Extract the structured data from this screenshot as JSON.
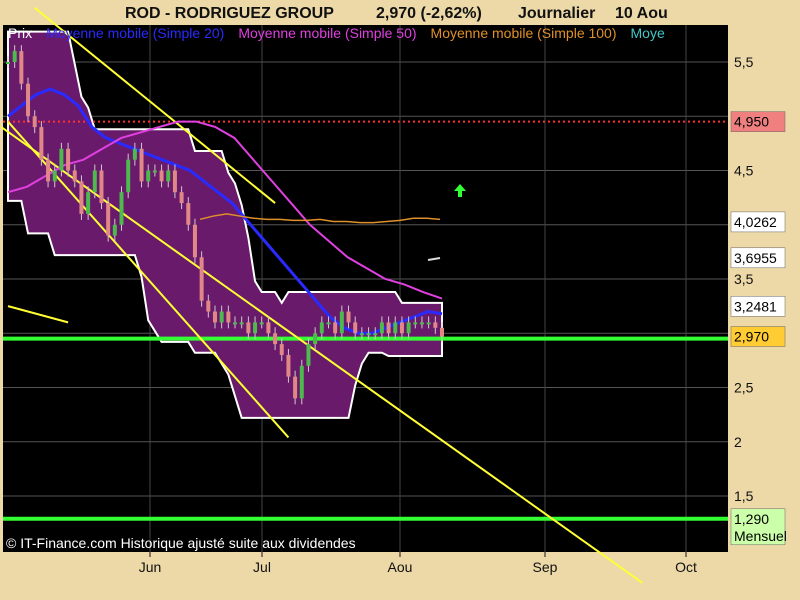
{
  "title": {
    "name": "ROD - RODRIGUEZ GROUP",
    "price_change": "2,970 (-2,62%)",
    "period": "Journalier",
    "date": "10 Aou"
  },
  "legend": [
    {
      "label": "Prix",
      "color": "#ffffff"
    },
    {
      "label": "Moyenne mobile (Simple 20)",
      "color": "#2a2aff"
    },
    {
      "label": "Moyenne mobile (Simple 50)",
      "color": "#e040e0"
    },
    {
      "label": "Moyenne mobile (Simple 100)",
      "color": "#e0902a"
    },
    {
      "label": "Moye",
      "color": "#40c8c8"
    }
  ],
  "copyright": "© IT-Finance.com Historique ajusté suite aux dividendes",
  "chart_data": {
    "type": "candlestick",
    "x_tick_labels": [
      "Jun",
      "Jul",
      "Aou",
      "Sep",
      "Oct"
    ],
    "y_tick_labels": [
      "5,5",
      "4,5",
      "3,5",
      "2,5",
      "2",
      "1,5"
    ],
    "ylim": [
      1.25,
      5.75
    ],
    "colors": {
      "background": "#000000",
      "frame": "#ecd9a7",
      "bollinger_fill": "#6a1a6a",
      "bollinger_edge": "#ffffff",
      "up_candle": "#4cba4c",
      "down_candle": "#e08888",
      "trendline": "#ffff33",
      "support": "#33ff33",
      "resistance": "#ff3030"
    },
    "price_flags": [
      {
        "label": "4,950",
        "value": 4.95,
        "bg": "#f08080"
      },
      {
        "label": "4,0262",
        "value": 4.0262,
        "bg": "#ffffff"
      },
      {
        "label": "3,6955",
        "value": 3.6955,
        "bg": "#ffffff"
      },
      {
        "label": "3,2481",
        "value": 3.2481,
        "bg": "#ffffff"
      },
      {
        "label": "2,970",
        "value": 2.97,
        "bg": "#ffcc33"
      },
      {
        "label": "1,290",
        "sublabel": "Mensuel",
        "value": 1.29,
        "bg": "#ccffaa"
      }
    ],
    "horizontal_levels": [
      {
        "value": 4.95,
        "style": "dotted",
        "color": "#ff3030"
      },
      {
        "value": 2.95,
        "style": "solid",
        "color": "#33ff33"
      },
      {
        "value": 1.29,
        "style": "solid",
        "color": "#33ff33"
      }
    ],
    "close": [
      5.5,
      5.6,
      5.3,
      5.0,
      4.9,
      4.6,
      4.4,
      4.5,
      4.7,
      4.5,
      4.4,
      4.1,
      4.3,
      4.5,
      4.2,
      3.9,
      4.0,
      4.3,
      4.6,
      4.7,
      4.4,
      4.5,
      4.5,
      4.4,
      4.5,
      4.3,
      4.2,
      4.0,
      3.7,
      3.3,
      3.2,
      3.1,
      3.2,
      3.1,
      3.1,
      3.1,
      3.0,
      3.1,
      3.1,
      3.0,
      2.9,
      2.8,
      2.6,
      2.4,
      2.7,
      2.9,
      3.0,
      3.1,
      3.1,
      3.0,
      3.2,
      3.1,
      3.0,
      3.0,
      3.0,
      3.0,
      3.1,
      3.0,
      3.1,
      3.0,
      3.1,
      3.1,
      3.1,
      3.1,
      3.05,
      2.97
    ],
    "sma20": [
      5.0,
      5.1,
      5.2,
      5.25,
      5.2,
      5.1,
      4.9,
      4.8,
      4.75,
      4.7,
      4.65,
      4.6,
      4.55,
      4.5,
      4.4,
      4.3,
      4.2,
      4.05,
      3.9,
      3.75,
      3.6,
      3.45,
      3.3,
      3.15,
      3.05,
      3.0,
      3.0,
      3.05,
      3.1,
      3.15,
      3.2,
      3.18
    ],
    "sma50": [
      4.3,
      4.35,
      4.45,
      4.55,
      4.6,
      4.7,
      4.8,
      4.85,
      4.9,
      4.95,
      4.95,
      4.9,
      4.8,
      4.6,
      4.4,
      4.2,
      4.0,
      3.85,
      3.7,
      3.6,
      3.5,
      3.45,
      3.38,
      3.32
    ],
    "sma100": [
      4.05,
      4.08,
      4.1,
      4.08,
      4.06,
      4.05,
      4.05,
      4.04,
      4.04,
      4.05,
      4.03,
      4.03,
      4.02,
      4.02,
      4.03,
      4.04,
      4.06,
      4.06,
      4.05
    ]
  }
}
